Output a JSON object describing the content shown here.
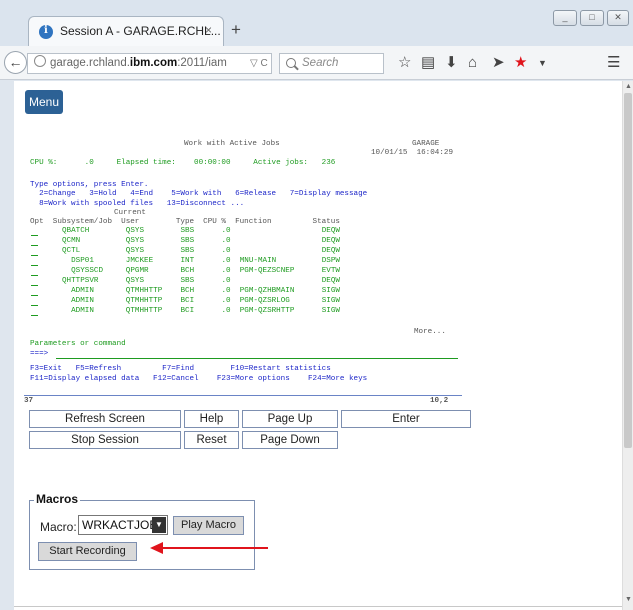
{
  "browser": {
    "tab_title": "Session A - GARAGE.RCHL...",
    "tab_close": "×",
    "new_tab": "+",
    "url_prefix": "garage.rchland.",
    "url_domain": "ibm.com",
    "url_rest": ":2011/iam",
    "url_tools": "▽ C",
    "search_placeholder": "Search",
    "window_buttons": [
      "_",
      "□",
      "✕"
    ]
  },
  "menu_label": "Menu",
  "terminal": {
    "screen_title": "Work with Active Jobs",
    "system": "GARAGE",
    "date_time": "10/01/15  16:04:29",
    "cpu_line": "CPU %:      .0     Elapsed time:    00:00:00     Active jobs:   236",
    "instructions": [
      "Type options, press Enter.",
      "  2=Change   3=Hold   4=End    5=Work with   6=Release   7=Display message",
      "  8=Work with spooled files   13=Disconnect ..."
    ],
    "header_current": "Current",
    "column_header": "Opt  Subsystem/Job  User        Type  CPU %  Function         Status",
    "rows": [
      "QBATCH        QSYS        SBS      .0                    DEQW",
      "QCMN          QSYS        SBS      .0                    DEQW",
      "QCTL          QSYS        SBS      .0                    DEQW",
      "  DSP01       JMCKEE      INT      .0  MNU-MAIN          DSPW",
      "  QSYSSCD     QPGMR       BCH      .0  PGM-QEZSCNEP      EVTW",
      "QHTTPSVR      QSYS        SBS      .0                    DEQW",
      "  ADMIN       QTMHHTTP    BCH      .0  PGM-QZHBMAIN      SIGW",
      "  ADMIN       QTMHHTTP    BCI      .0  PGM-QZSRLOG       SIGW",
      "  ADMIN       QTMHHTTP    BCI      .0  PGM-QZSRHTTP      SIGW"
    ],
    "more": "More...",
    "params_label": "Parameters or command",
    "prompt": "===>",
    "fkeys_1": "F3=Exit   F5=Refresh         F7=Find        F10=Restart statistics",
    "fkeys_2": "F11=Display elapsed data   F12=Cancel    F23=More options    F24=More keys",
    "status_left": "37",
    "status_right": "10,2"
  },
  "buttons": {
    "refresh": "Refresh Screen",
    "help": "Help",
    "page_up": "Page Up",
    "enter": "Enter",
    "stop": "Stop Session",
    "reset": "Reset",
    "page_down": "Page Down"
  },
  "macros": {
    "legend": "Macros",
    "label": "Macro:",
    "selected": "WRKACTJOB",
    "play": "Play Macro",
    "record": "Start Recording"
  },
  "colors": {
    "terminal_green": "#1e9b20",
    "terminal_blue": "#1d26c8",
    "menu_blue": "#2c6195",
    "arrow_red": "#e0141c"
  }
}
